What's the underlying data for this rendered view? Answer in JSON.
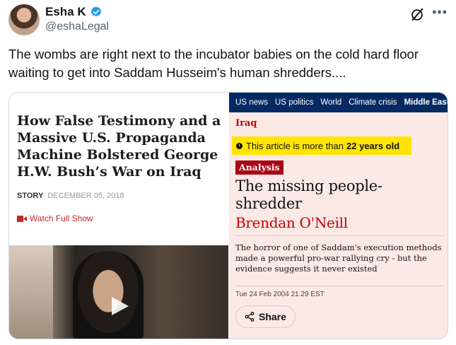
{
  "author": {
    "display_name": "Esha K",
    "handle": "@eshaLegal"
  },
  "tweet": {
    "text": "The wombs are right next to the incubator babies on the cold hard floor waiting to get into Saddam Husseim's human shredders...."
  },
  "left_card": {
    "title": "How False Testimony and a Massive U.S. Propaganda Machine Bolstered George H.W. Bush’s War on Iraq",
    "story_label": "STORY",
    "date": "DECEMBER 05, 2018",
    "watch_label": "Watch Full Show"
  },
  "right_card": {
    "nav": [
      "US news",
      "US politics",
      "World",
      "Climate crisis",
      "Middle East"
    ],
    "kicker": "Iraq",
    "age_notice": "This article is more than",
    "age_value": "22 years old",
    "badge": "Analysis",
    "headline": "The missing people-shredder",
    "byline": "Brendan O'Neill",
    "standfirst": "The horror of one of Saddam's execution methods made a powerful pro-war rallying cry - but the evidence suggests it never existed",
    "dateline": "Tue 24 Feb 2004 21.29 EST",
    "share_label": "Share"
  },
  "icons": {
    "verified": "verified-badge-icon",
    "grok": "grok-icon",
    "more": "more-icon",
    "play": "play-icon",
    "camera": "camera-icon",
    "clock": "clock-icon",
    "share": "share-icon"
  },
  "colors": {
    "verified_blue": "#1d9bf0",
    "guardian_navy": "#052962",
    "guardian_red": "#c70000",
    "banner_yellow": "#ffe500",
    "card_pink": "#fbe9e6"
  }
}
